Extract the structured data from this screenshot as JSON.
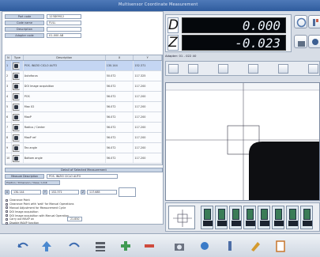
{
  "window": {
    "title": "Multisensor Coordinate Measurement"
  },
  "fields": [
    {
      "label": "Part code",
      "value": "123DEM12"
    },
    {
      "label": "Code name",
      "value": "FULL"
    },
    {
      "label": "Description",
      "value": ""
    },
    {
      "label": "Adapter code",
      "value": "01-000 AB"
    }
  ],
  "table": {
    "headers": [
      "N",
      "Type",
      "Description",
      "X",
      "Y"
    ],
    "rows": [
      {
        "n": "1",
        "desc": "POS. INIZIO CICLO AUTO",
        "x": "130.144",
        "y": "152.371"
      },
      {
        "n": "2",
        "desc": "Autofocus",
        "x": "50.072",
        "y": "117.325"
      },
      {
        "n": "3",
        "desc": "DOI Image acquisition",
        "x": "56.072",
        "y": "117.200"
      },
      {
        "n": "4",
        "desc": "POS",
        "x": "56.072",
        "y": "117.200"
      },
      {
        "n": "5",
        "desc": "Max X2",
        "x": "56.072",
        "y": "117.200"
      },
      {
        "n": "6",
        "desc": "MaxP",
        "x": "56.072",
        "y": "117.200"
      },
      {
        "n": "7",
        "desc": "Radius / Center",
        "x": "56.072",
        "y": "117.200"
      },
      {
        "n": "8",
        "desc": "MaxP ref",
        "x": "56.072",
        "y": "117.200"
      },
      {
        "n": "9",
        "desc": "Tex angle",
        "x": "56.072",
        "y": "117.200"
      },
      {
        "n": "10",
        "desc": "Bottom angle",
        "x": "56.072",
        "y": "117.200"
      }
    ]
  },
  "detail": {
    "title": "Detail of Selected Measurement",
    "measure_label": "Measure Description",
    "measure_value": "POS. INIZIO CICLO AUTO",
    "position_label": "Position / Dimension / Class / Limit",
    "x_label": "X",
    "x_value": "130.144",
    "y_label": "Y",
    "y_value": "152.371",
    "z_label": "Z",
    "z_value": "117.685",
    "options": [
      "Clearance Point",
      "Clearance Point with 'wait' for Manual Operations",
      "Manual Adjustment for Measurement Cycle",
      "DOI Image acquisition",
      "DOI Image acquisition with Manual Operation",
      "Carry out MAXP on",
      "Disable MAXP function"
    ],
    "extra_value": "21.850"
  },
  "dro": [
    {
      "axis": "D",
      "value": "0.000"
    },
    {
      "axis": "Z",
      "value": "-0.023"
    }
  ],
  "adapter_text": "Adapter: 01 - 022 40"
}
